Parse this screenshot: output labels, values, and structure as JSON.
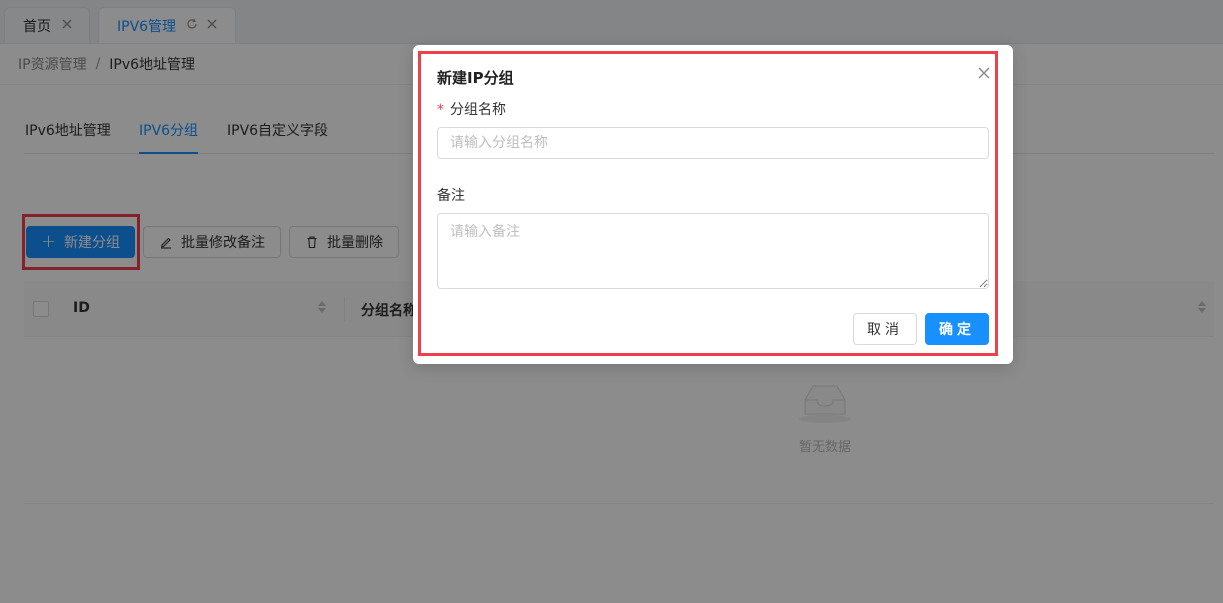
{
  "tabs": [
    {
      "label": "首页"
    },
    {
      "label": "IPV6管理"
    }
  ],
  "breadcrumb": {
    "parent": "IP资源管理",
    "separator": "/",
    "current": "IPv6地址管理"
  },
  "subtabs": [
    {
      "label": "IPv6地址管理"
    },
    {
      "label": "IPV6分组",
      "active": true
    },
    {
      "label": "IPV6自定义字段"
    }
  ],
  "toolbar": {
    "new_group": "新建分组",
    "batch_edit_remark": "批量修改备注",
    "batch_delete": "批量删除"
  },
  "table": {
    "columns": [
      "ID",
      "分组名称"
    ],
    "empty_text": "暂无数据"
  },
  "modal": {
    "title": "新建IP分组",
    "name_label": "分组名称",
    "name_required_mark": "*",
    "name_placeholder": "请输入分组名称",
    "remark_label": "备注",
    "remark_placeholder": "请输入备注",
    "cancel": "取消",
    "ok": "确定"
  },
  "colors": {
    "primary": "#1890ff",
    "highlight": "#ee3f4d"
  }
}
